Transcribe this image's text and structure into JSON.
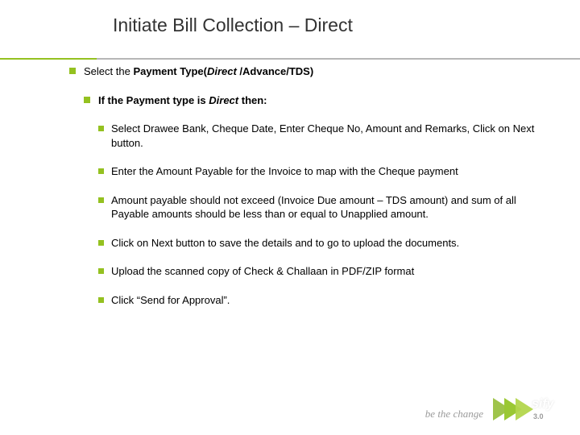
{
  "title": "Initiate Bill Collection – Direct",
  "content": {
    "level1": {
      "prefix": "Select the ",
      "bold1": "Payment Type(",
      "italic1": "Direct",
      "bold2": " /Advance/TDS",
      "bold3": ")"
    },
    "level2": {
      "prefix": "If the Payment type is ",
      "italic": "Direct",
      "suffix": " then:"
    },
    "level3": [
      "Select Drawee Bank, Cheque Date, Enter Cheque No, Amount and Remarks, Click on Next button.",
      "Enter the Amount Payable for the Invoice to map with the Cheque payment",
      "Amount payable should not exceed (Invoice Due amount – TDS amount) and sum of all Payable amounts should be less than or equal to Unapplied amount.",
      "Click on Next button to save the details and to go to upload  the documents.",
      "Upload the scanned copy of Check & Challaan in PDF/ZIP format",
      "Click “Send for Approval”."
    ]
  },
  "footer": {
    "tagline": "be the change",
    "logo_label": "sify",
    "logo_tm": "®",
    "logo_sub": "3.0"
  }
}
